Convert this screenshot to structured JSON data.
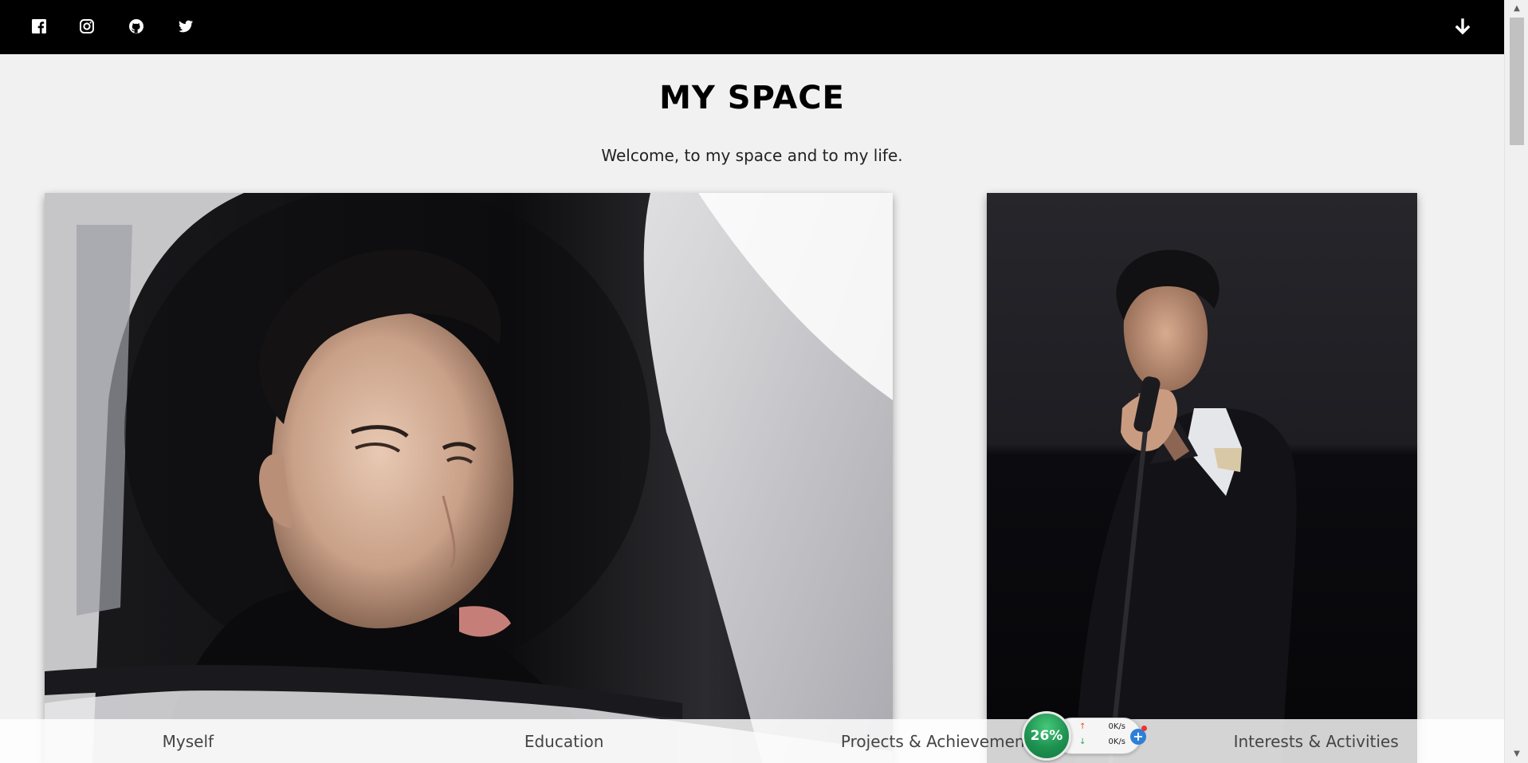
{
  "header": {
    "social_icons": [
      "facebook-icon",
      "instagram-icon",
      "github-icon",
      "twitter-icon"
    ],
    "scroll_down_icon": "arrow-down-icon"
  },
  "hero": {
    "title": "MY SPACE",
    "subtitle": "Welcome, to my space and to my life."
  },
  "photos": [
    {
      "name": "portrait-in-car-mirror"
    },
    {
      "name": "singing-on-stage"
    }
  ],
  "bottom_nav": {
    "items": [
      {
        "label": "Myself"
      },
      {
        "label": "Education"
      },
      {
        "label": "Projects & Achievements"
      },
      {
        "label": "Interests & Activities"
      }
    ]
  },
  "net_widget": {
    "percent": "26%",
    "upload": "0K/s",
    "download": "0K/s"
  },
  "colors": {
    "topbar": "#000000",
    "background": "#f1f1f1",
    "widget_green": "#1e9150"
  }
}
